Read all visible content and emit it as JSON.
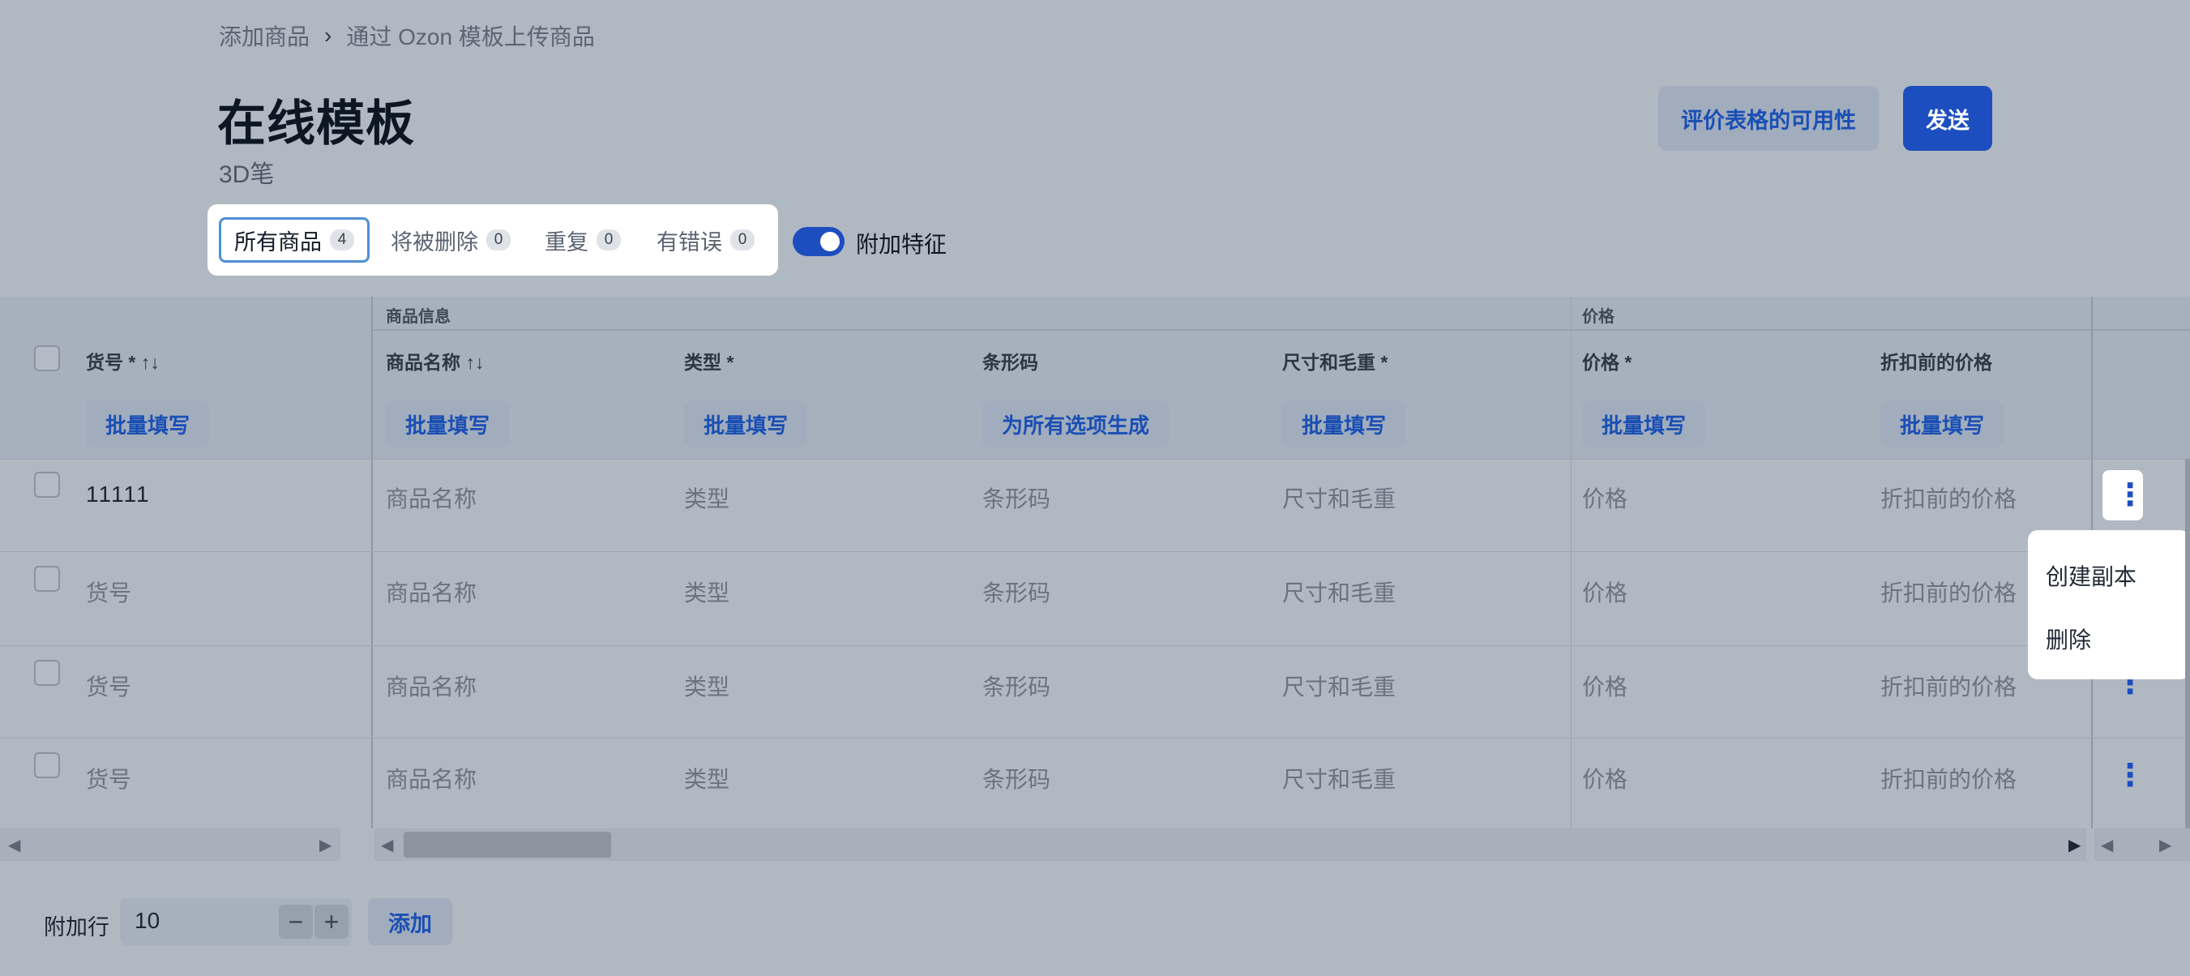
{
  "breadcrumb": {
    "item1": "添加商品",
    "item2": "通过 Ozon 模板上传商品"
  },
  "page": {
    "title": "在线模板",
    "subtitle": "3D笔"
  },
  "actions": {
    "evaluate": "评价表格的可用性",
    "send": "发送"
  },
  "tabs": [
    {
      "label": "所有商品",
      "count": "4"
    },
    {
      "label": "将被删除",
      "count": "0"
    },
    {
      "label": "重复",
      "count": "0"
    },
    {
      "label": "有错误",
      "count": "0"
    }
  ],
  "toggle": {
    "label": "附加特征",
    "on": true
  },
  "groups": {
    "info": "商品信息",
    "price": "价格"
  },
  "columns": {
    "sku": "货号 * ↑↓",
    "name": "商品名称 ↑↓",
    "type": "类型 *",
    "barcode": "条形码",
    "dims": "尺寸和毛重 *",
    "price": "价格 *",
    "old_price": "折扣前的价格"
  },
  "fill": {
    "bulk": "批量填写",
    "generate": "为所有选项生成"
  },
  "rows": [
    {
      "sku": "11111",
      "name": "商品名称",
      "type": "类型",
      "barcode": "条形码",
      "dims": "尺寸和毛重",
      "price": "价格",
      "old_price": "折扣前的价格"
    },
    {
      "sku": "货号",
      "name": "商品名称",
      "type": "类型",
      "barcode": "条形码",
      "dims": "尺寸和毛重",
      "price": "价格",
      "old_price": "折扣前的价格"
    },
    {
      "sku": "货号",
      "name": "商品名称",
      "type": "类型",
      "barcode": "条形码",
      "dims": "尺寸和毛重",
      "price": "价格",
      "old_price": "折扣前的价格"
    },
    {
      "sku": "货号",
      "name": "商品名称",
      "type": "类型",
      "barcode": "条形码",
      "dims": "尺寸和毛重",
      "price": "价格",
      "old_price": "折扣前的价格"
    }
  ],
  "menu": {
    "duplicate": "创建副本",
    "delete": "删除"
  },
  "footer": {
    "label": "附加行",
    "value": "10",
    "add": "添加"
  },
  "icons": {
    "kebab": "more-vertical-icon",
    "chevron": "chevron-right-icon"
  },
  "colors": {
    "accent": "#1d4ebf",
    "background": "#b0b8c2"
  }
}
